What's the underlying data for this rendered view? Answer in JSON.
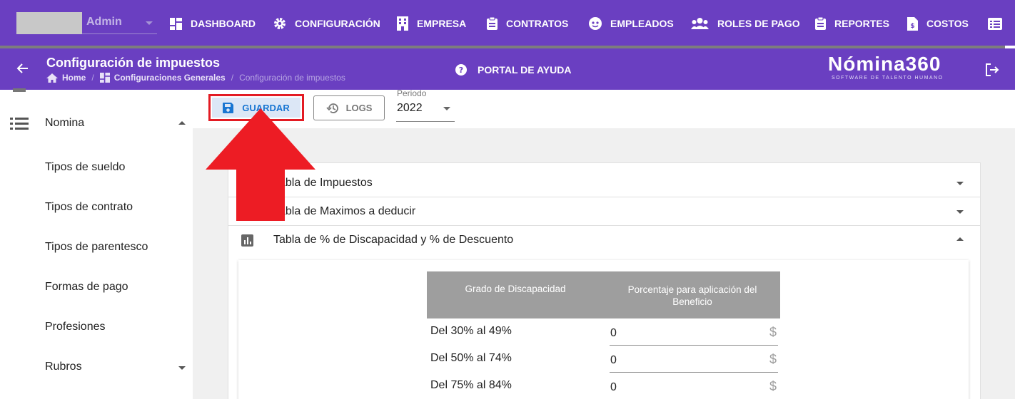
{
  "topnav": {
    "user_label": "Admin",
    "items": [
      {
        "label": "DASHBOARD",
        "icon": "dashboard-icon"
      },
      {
        "label": "CONFIGURACIÓN",
        "icon": "gear-icon"
      },
      {
        "label": "EMPRESA",
        "icon": "building-icon"
      },
      {
        "label": "CONTRATOS",
        "icon": "clipboard-icon"
      },
      {
        "label": "EMPLEADOS",
        "icon": "face-icon"
      },
      {
        "label": "ROLES DE PAGO",
        "icon": "users-icon"
      },
      {
        "label": "REPORTES",
        "icon": "clipboard-icon"
      },
      {
        "label": "COSTOS",
        "icon": "invoice-icon"
      }
    ]
  },
  "header": {
    "title": "Configuración de impuestos",
    "breadcrumb": [
      "Home",
      "Configuraciones Generales",
      "Configuración de impuestos"
    ],
    "help_label": "PORTAL DE AYUDA",
    "brand_name": "Nómina360",
    "brand_tagline": "SOFTWARE DE TALENTO HUMANO"
  },
  "sidebar": {
    "group_label": "Nomina",
    "items": [
      {
        "label": "Tipos de sueldo"
      },
      {
        "label": "Tipos de contrato"
      },
      {
        "label": "Tipos de parentesco"
      },
      {
        "label": "Formas de pago"
      },
      {
        "label": "Profesiones"
      },
      {
        "label": "Rubros"
      }
    ]
  },
  "toolbar": {
    "save_label": "GUARDAR",
    "logs_label": "LOGS",
    "period_label": "Periodo",
    "period_value": "2022"
  },
  "accordion": {
    "sections": [
      {
        "title": "Tabla de Impuestos",
        "expanded": false
      },
      {
        "title": "Tabla de Maximos a deducir",
        "expanded": false
      },
      {
        "title": "Tabla de % de Discapacidad y % de Descuento",
        "expanded": true
      }
    ]
  },
  "disability_table": {
    "headers": [
      "Grado de Discapacidad",
      "Porcentaje para aplicación del Beneficio"
    ],
    "rows": [
      {
        "grade": "Del 30% al 49%",
        "value": "0",
        "unit": "$"
      },
      {
        "grade": "Del 50% al 74%",
        "value": "0",
        "unit": "$"
      },
      {
        "grade": "Del 75% al 84%",
        "value": "0",
        "unit": "$"
      }
    ]
  },
  "colors": {
    "header_bg": "#6a3fc1",
    "save_text": "#1976d2",
    "save_bg": "#dce7f6",
    "highlight_red": "#e31b23",
    "table_header_bg": "#9e9e9e"
  }
}
